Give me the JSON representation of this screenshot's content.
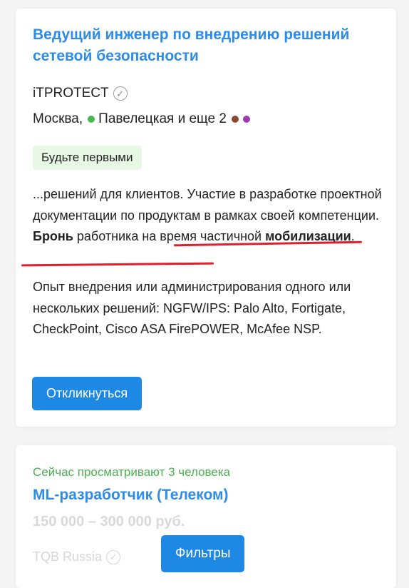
{
  "vacancy1": {
    "title": "Ведущий инженер по внедрению решений сетевой безопасности",
    "company": "iTPROTECT",
    "city": "Москва,",
    "metro": "Павелецкая и еще 2",
    "badge": "Будьте первыми",
    "snippet": {
      "part1": "...решений для клиентов. Участие в разработке проектной документации по продуктам в рамках своей компетенции. ",
      "bold1": "Бронь",
      "part2": " работника на время частичной ",
      "bold2": "мобилизации",
      "part3": "."
    },
    "requirements": "Опыт внедрения или администрирования одного или нескольких решений: NGFW/IPS: Palo Alto, Fortigate, CheckPoint, Cisco ASA FirePOWER, McAfee NSP.",
    "respond_label": "Откликнуться"
  },
  "vacancy2": {
    "viewers": "Сейчас просматривают 3 человека",
    "title": "ML-разработчик (Телеком)",
    "salary": "150 000 – 300 000 руб.",
    "company": "TQB Russia"
  },
  "filters_label": "Фильтры",
  "colors": {
    "accent": "#1e88e5",
    "title": "#2d8ce8",
    "viewers": "#4caf50",
    "annotation": "#e01e2c",
    "metro_dots": [
      "#43b94f",
      "#8a4a2f",
      "#9c3cb0"
    ]
  },
  "icons": [
    "verified-check-icon"
  ]
}
